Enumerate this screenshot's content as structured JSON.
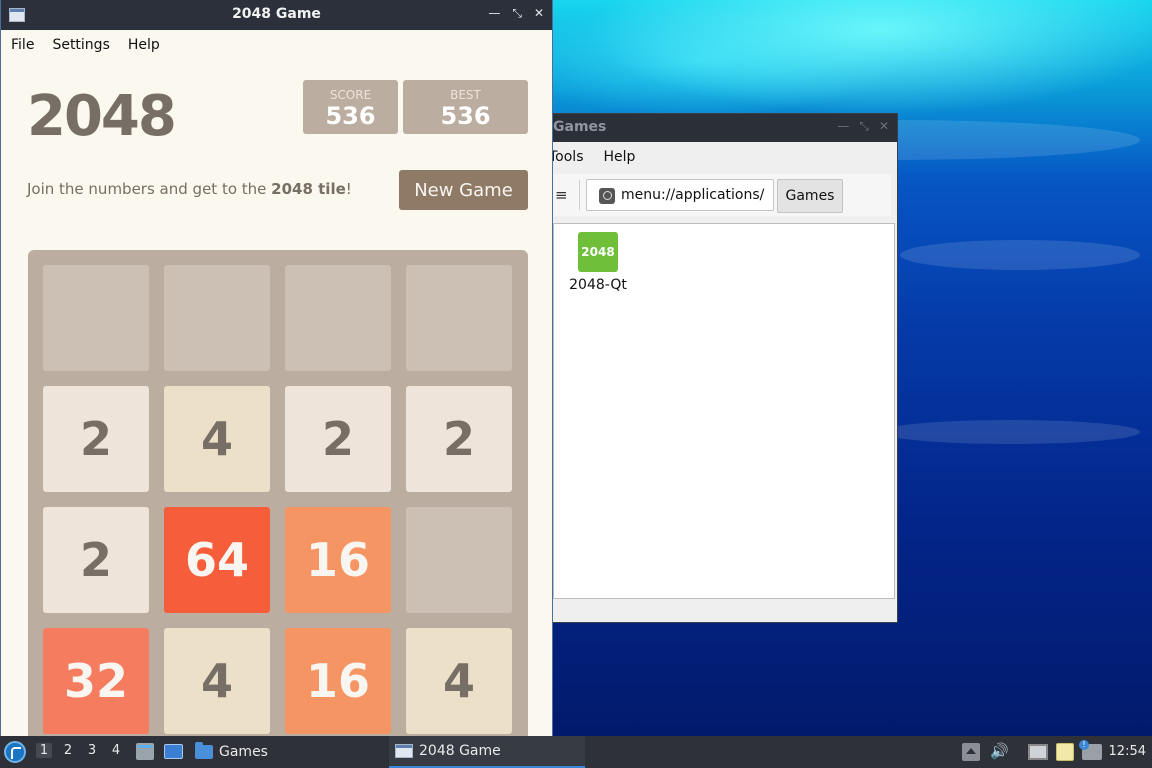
{
  "game_window": {
    "title": "2048 Game",
    "menu": [
      "File",
      "Settings",
      "Help"
    ],
    "logo": "2048",
    "score_label": "SCORE",
    "score": "536",
    "best_label": "BEST",
    "best": "536",
    "intro_prefix": "Join the numbers and get to the ",
    "intro_bold": "2048 tile",
    "intro_suffix": "!",
    "new_game": "New Game",
    "board": [
      [
        "",
        "",
        "",
        ""
      ],
      [
        "2",
        "4",
        "2",
        "2"
      ],
      [
        "2",
        "64",
        "16",
        ""
      ],
      [
        "32",
        "4",
        "16",
        "4"
      ]
    ]
  },
  "file_manager": {
    "title": "Games",
    "menu": [
      "Tools",
      "Help"
    ],
    "path": "menu://applications/",
    "breadcrumb": "Games",
    "items": [
      {
        "label": "2048-Qt",
        "icon_text": "2048"
      }
    ]
  },
  "taskbar": {
    "workspaces": [
      "1",
      "2",
      "3",
      "4"
    ],
    "tasks": [
      "Games",
      "2048 Game"
    ],
    "clock": "12:54"
  },
  "colors": {
    "tile_2": "#eee4da",
    "tile_4": "#ede0c8",
    "tile_16": "#f59563",
    "tile_32": "#f67c5f",
    "tile_64": "#f65e3b",
    "board": "#bbada0",
    "button": "#8f7a66"
  }
}
